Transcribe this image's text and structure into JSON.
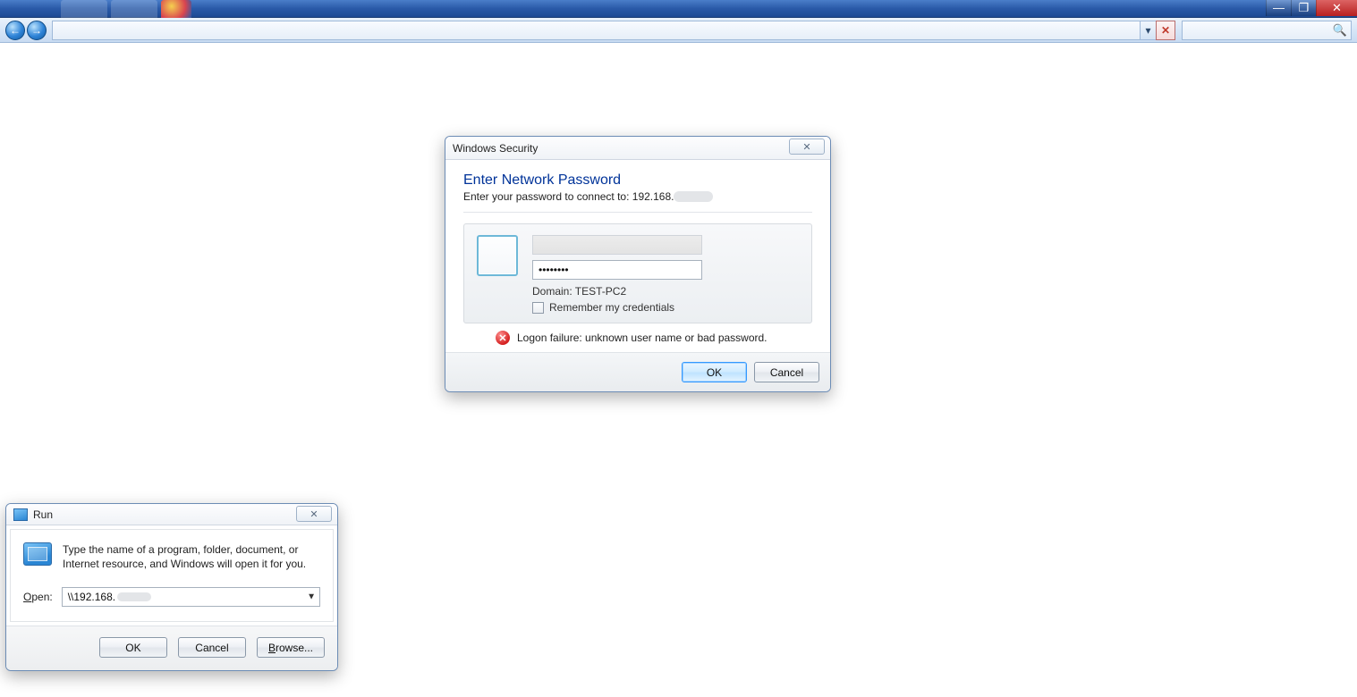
{
  "window_controls": {
    "minimize": "—",
    "maximize": "❐",
    "close": "✕"
  },
  "explorer": {
    "nav_back": "←",
    "nav_fwd": "→",
    "address_dropdown": "▾",
    "refresh_glyph": "✕",
    "search_glyph": "🔍"
  },
  "security_dialog": {
    "title": "Windows Security",
    "close_glyph": "✕",
    "heading": "Enter Network Password",
    "subtext_prefix": "Enter your password to connect to: 192.168.",
    "username_value": "",
    "password_masked": "••••••••",
    "domain_label": "Domain: TEST-PC2",
    "remember_label": "Remember my credentials",
    "error_text": "Logon failure: unknown user name or bad password.",
    "ok_label": "OK",
    "cancel_label": "Cancel"
  },
  "run_dialog": {
    "title": "Run",
    "close_glyph": "✕",
    "description": "Type the name of a program, folder, document, or Internet resource, and Windows will open it for you.",
    "open_label_u": "O",
    "open_label_rest": "pen:",
    "open_value_prefix": "\\\\192.168.",
    "ok_label": "OK",
    "cancel_label": "Cancel",
    "browse_label_u": "B",
    "browse_label_rest": "rowse..."
  }
}
